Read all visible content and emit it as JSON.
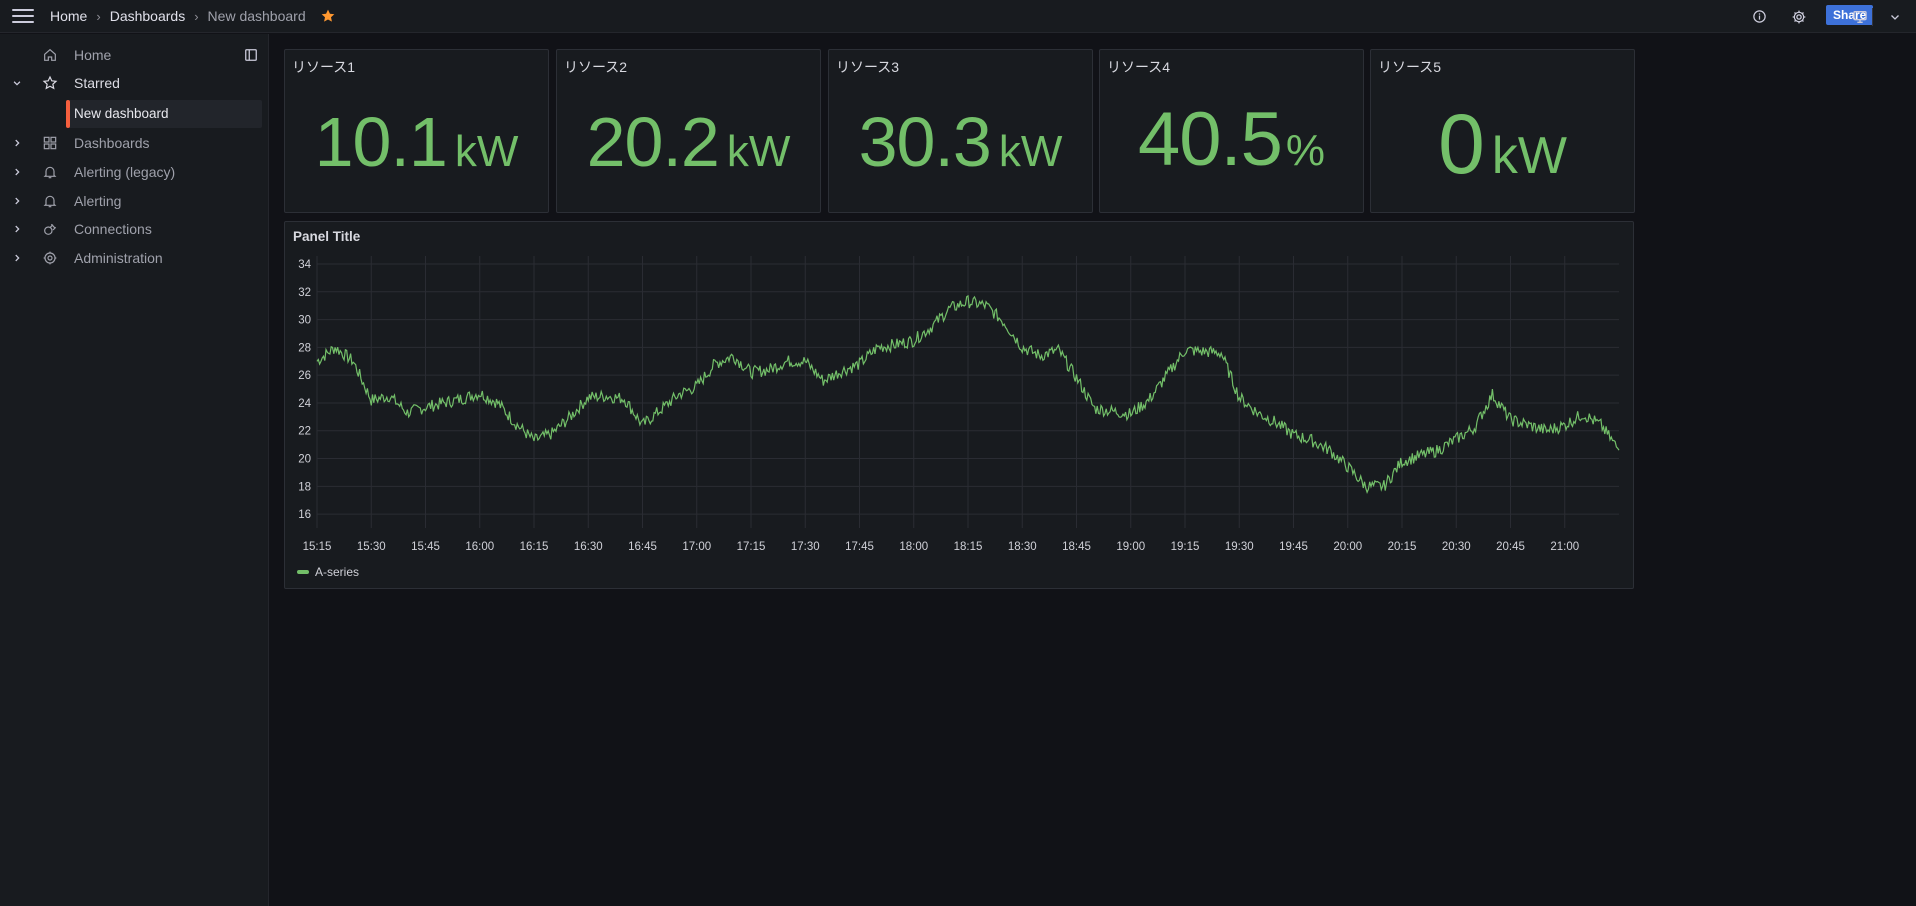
{
  "topbar": {
    "menu_icon": "hamburger-icon",
    "breadcrumbs": [
      "Home",
      "Dashboards",
      "New dashboard"
    ],
    "separator": "›",
    "favorite_icon": "star-icon",
    "share_label": "Share",
    "icons": [
      "help-icon",
      "gear-icon",
      "kiosk-icon",
      "chevron-down-icon"
    ]
  },
  "sidebar": {
    "items": [
      {
        "label": "Home",
        "icon": "home-icon"
      },
      {
        "label": "Starred",
        "icon": "star-icon",
        "expanded": true
      },
      {
        "label": "Dashboards",
        "icon": "apps-icon"
      },
      {
        "label": "Alerting (legacy)",
        "icon": "bell-icon"
      },
      {
        "label": "Alerting",
        "icon": "bell-icon"
      },
      {
        "label": "Connections",
        "icon": "plug-icon"
      },
      {
        "label": "Administration",
        "icon": "gear-icon"
      }
    ],
    "starred_child": "New dashboard"
  },
  "stats": [
    {
      "title": "リソース1",
      "value": "10.1",
      "unit": "kW"
    },
    {
      "title": "リソース2",
      "value": "20.2",
      "unit": "kW"
    },
    {
      "title": "リソース3",
      "value": "30.3",
      "unit": "kW"
    },
    {
      "title": "リソース4",
      "value": "40.5",
      "unit": "%"
    },
    {
      "title": "リソース5",
      "value": "0",
      "unit": "kW"
    }
  ],
  "colors": {
    "accent": "#73bf69",
    "share": "#3d71d9",
    "active_bar": "#f55f3e",
    "favorite": "#ff9830"
  },
  "chart_data": {
    "type": "line",
    "title": "Panel Title",
    "x_tick_labels": [
      "15:15",
      "15:30",
      "15:45",
      "16:00",
      "16:15",
      "16:30",
      "16:45",
      "17:00",
      "17:15",
      "17:30",
      "17:45",
      "18:00",
      "18:15",
      "18:30",
      "18:45",
      "19:00",
      "19:15",
      "19:30",
      "19:45",
      "20:00",
      "20:15",
      "20:30",
      "20:45",
      "21:00"
    ],
    "y_ticks": [
      16,
      18,
      20,
      22,
      24,
      26,
      28,
      30,
      32,
      34
    ],
    "ylim": [
      15,
      34
    ],
    "xlim": [
      "15:15",
      "21:15"
    ],
    "grid": true,
    "legend_position": "bottom-left",
    "series": [
      {
        "name": "A-series",
        "color": "#73bf69",
        "points": [
          [
            "15:15",
            27
          ],
          [
            "15:20",
            28
          ],
          [
            "15:25",
            27
          ],
          [
            "15:30",
            24.2
          ],
          [
            "15:35",
            24.5
          ],
          [
            "15:40",
            23.3
          ],
          [
            "15:45",
            23.7
          ],
          [
            "15:50",
            24
          ],
          [
            "15:55",
            24.3
          ],
          [
            "16:00",
            24.7
          ],
          [
            "16:05",
            24
          ],
          [
            "16:10",
            22.5
          ],
          [
            "16:15",
            21.3
          ],
          [
            "16:20",
            21.8
          ],
          [
            "16:25",
            23
          ],
          [
            "16:30",
            24.4
          ],
          [
            "16:35",
            24.5
          ],
          [
            "16:40",
            24.3
          ],
          [
            "16:45",
            22.4
          ],
          [
            "16:50",
            23.5
          ],
          [
            "16:55",
            24.6
          ],
          [
            "17:00",
            25.2
          ],
          [
            "17:05",
            26.8
          ],
          [
            "17:10",
            27.4
          ],
          [
            "17:15",
            26.2
          ],
          [
            "17:20",
            26.4
          ],
          [
            "17:25",
            27
          ],
          [
            "17:30",
            27
          ],
          [
            "17:35",
            25.6
          ],
          [
            "17:40",
            26.3
          ],
          [
            "17:45",
            26.8
          ],
          [
            "17:50",
            28
          ],
          [
            "17:55",
            28.2
          ],
          [
            "18:00",
            28.5
          ],
          [
            "18:05",
            29.5
          ],
          [
            "18:10",
            30.8
          ],
          [
            "18:15",
            31.3
          ],
          [
            "18:20",
            31
          ],
          [
            "18:25",
            29.8
          ],
          [
            "18:30",
            28
          ],
          [
            "18:35",
            27.4
          ],
          [
            "18:40",
            27.8
          ],
          [
            "18:45",
            25.8
          ],
          [
            "18:50",
            23.6
          ],
          [
            "18:55",
            23.4
          ],
          [
            "19:00",
            23.2
          ],
          [
            "19:05",
            24.2
          ],
          [
            "19:10",
            26
          ],
          [
            "19:15",
            27.8
          ],
          [
            "19:20",
            27.7
          ],
          [
            "19:25",
            27.6
          ],
          [
            "19:30",
            24.4
          ],
          [
            "19:35",
            23.3
          ],
          [
            "19:40",
            22.6
          ],
          [
            "19:45",
            21.7
          ],
          [
            "19:50",
            21.3
          ],
          [
            "19:55",
            20.6
          ],
          [
            "20:00",
            19.4
          ],
          [
            "20:05",
            18
          ],
          [
            "20:10",
            18
          ],
          [
            "20:15",
            19.8
          ],
          [
            "20:20",
            20.2
          ],
          [
            "20:25",
            20.6
          ],
          [
            "20:30",
            21.4
          ],
          [
            "20:35",
            22.2
          ],
          [
            "20:40",
            24.6
          ],
          [
            "20:45",
            22.8
          ],
          [
            "20:50",
            22.4
          ],
          [
            "20:55",
            22
          ],
          [
            "21:00",
            22.4
          ],
          [
            "21:05",
            23.2
          ],
          [
            "21:10",
            22.4
          ],
          [
            "21:15",
            20.6
          ]
        ]
      }
    ]
  }
}
